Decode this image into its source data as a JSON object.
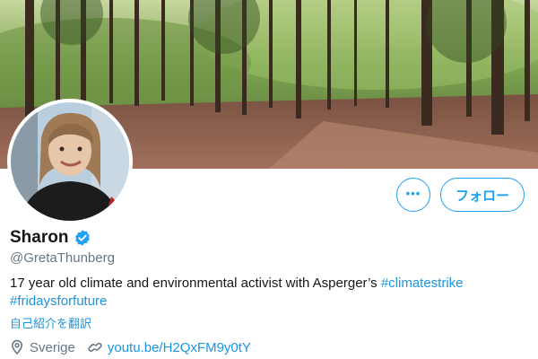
{
  "profile": {
    "display_name": "Sharon",
    "handle": "@GretaThunberg",
    "bio_text": "17 year old climate and environmental activist with Asperger’s ",
    "bio_hashtags": [
      "#climatestrike",
      "#fridaysforfuture"
    ],
    "translate_label": "自己紹介を翻訳",
    "location": "Sverige",
    "website": "youtu.be/H2QxFM9y0tY"
  },
  "actions": {
    "follow_label": "フォロー",
    "more_label": "•••"
  },
  "icons": {
    "more": "more-dots-icon",
    "verified": "verified-badge-icon",
    "location": "location-pin-icon",
    "link": "link-icon"
  },
  "colors": {
    "accent": "#1da1f2",
    "link": "#1b95e0",
    "secondary_text": "#657786",
    "verified": "#1da1f2"
  }
}
